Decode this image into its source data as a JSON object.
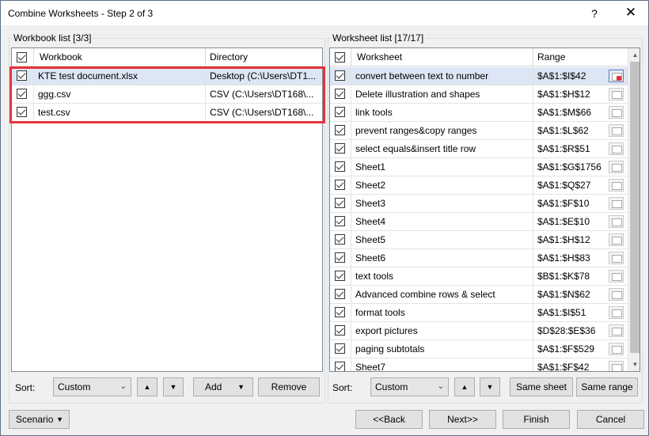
{
  "window": {
    "title": "Combine Worksheets - Step 2 of 3",
    "help": "?",
    "close": "✕"
  },
  "workbook_group": {
    "label": "Workbook list [3/3]",
    "columns": [
      "Workbook",
      "Directory"
    ],
    "rows": [
      {
        "name": "KTE test document.xlsx",
        "dir": "Desktop (C:\\Users\\DT1...",
        "checked": true,
        "selected": true
      },
      {
        "name": "ggg.csv",
        "dir": "CSV (C:\\Users\\DT168\\...",
        "checked": true,
        "selected": false
      },
      {
        "name": "test.csv",
        "dir": "CSV (C:\\Users\\DT168\\...",
        "checked": true,
        "selected": false
      }
    ],
    "sort_label": "Sort:",
    "sort_value": "Custom",
    "add_label": "Add",
    "remove_label": "Remove"
  },
  "worksheet_group": {
    "label": "Worksheet list [17/17]",
    "columns": [
      "Worksheet",
      "Range"
    ],
    "rows": [
      {
        "name": "convert between text to number",
        "range": "$A$1:$I$42",
        "selected": true
      },
      {
        "name": "Delete illustration and shapes",
        "range": "$A$1:$H$12"
      },
      {
        "name": "link tools",
        "range": "$A$1:$M$66"
      },
      {
        "name": "prevent ranges&copy ranges",
        "range": "$A$1:$L$62"
      },
      {
        "name": "select equals&insert title row",
        "range": "$A$1:$R$51"
      },
      {
        "name": "Sheet1",
        "range": "$A$1:$G$1756"
      },
      {
        "name": "Sheet2",
        "range": "$A$1:$Q$27"
      },
      {
        "name": "Sheet3",
        "range": "$A$1:$F$10"
      },
      {
        "name": "Sheet4",
        "range": "$A$1:$E$10"
      },
      {
        "name": "Sheet5",
        "range": "$A$1:$H$12"
      },
      {
        "name": "Sheet6",
        "range": "$A$1:$H$83"
      },
      {
        "name": "text tools",
        "range": "$B$1:$K$78"
      },
      {
        "name": "Advanced combine rows & select",
        "range": "$A$1:$N$62"
      },
      {
        "name": "format tools",
        "range": "$A$1:$I$51"
      },
      {
        "name": "export pictures",
        "range": "$D$28:$E$36"
      },
      {
        "name": "paging subtotals",
        "range": "$A$1:$F$529"
      },
      {
        "name": "Sheet7",
        "range": "$A$1:$F$42"
      }
    ],
    "sort_label": "Sort:",
    "sort_value": "Custom",
    "same_sheet_label": "Same sheet",
    "same_range_label": "Same range"
  },
  "footer": {
    "scenario_label": "Scenario",
    "back_label": "<<Back",
    "next_label": "Next>>",
    "finish_label": "Finish",
    "cancel_label": "Cancel"
  },
  "colors": {
    "highlight": "#e8333b",
    "selection": "#dce6f4"
  },
  "icons": {
    "range_picker": "range-select-icon",
    "up": "arrow-up-icon",
    "down": "arrow-down-icon",
    "dropdown": "chevron-down-icon"
  }
}
